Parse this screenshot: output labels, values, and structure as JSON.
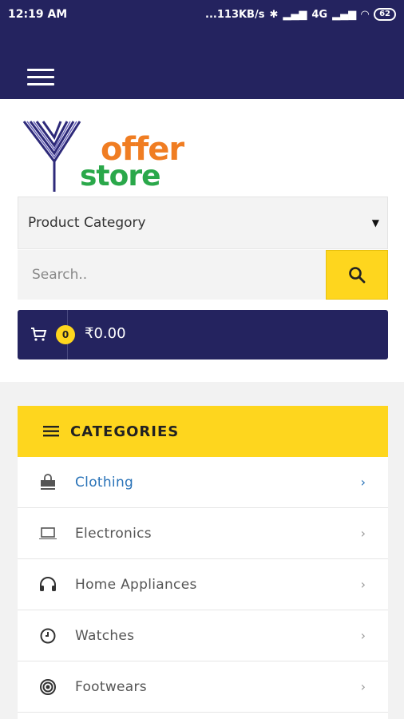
{
  "status_bar": {
    "time": "12:19 AM",
    "network_speed": "...113KB/s",
    "network_type": "4G",
    "battery": "62"
  },
  "search": {
    "category_select": "Product Category",
    "placeholder": "Search.."
  },
  "cart": {
    "count": "0",
    "total": "₹0.00"
  },
  "categories": {
    "title": "CATEGORIES",
    "items": [
      {
        "label": "Clothing",
        "icon": "shopping-bag-icon"
      },
      {
        "label": "Electronics",
        "icon": "laptop-icon"
      },
      {
        "label": "Home Appliances",
        "icon": "headphones-icon"
      },
      {
        "label": "Watches",
        "icon": "clock-icon"
      },
      {
        "label": "Footwears",
        "icon": "target-icon"
      }
    ]
  },
  "brand": {
    "logo_line1": "offer",
    "logo_line2": "store"
  },
  "colors": {
    "primary": "#24235f",
    "accent": "#fed61e",
    "active_link": "#2a73b8",
    "logo_orange": "#f07d22",
    "logo_green": "#2aa84a"
  }
}
